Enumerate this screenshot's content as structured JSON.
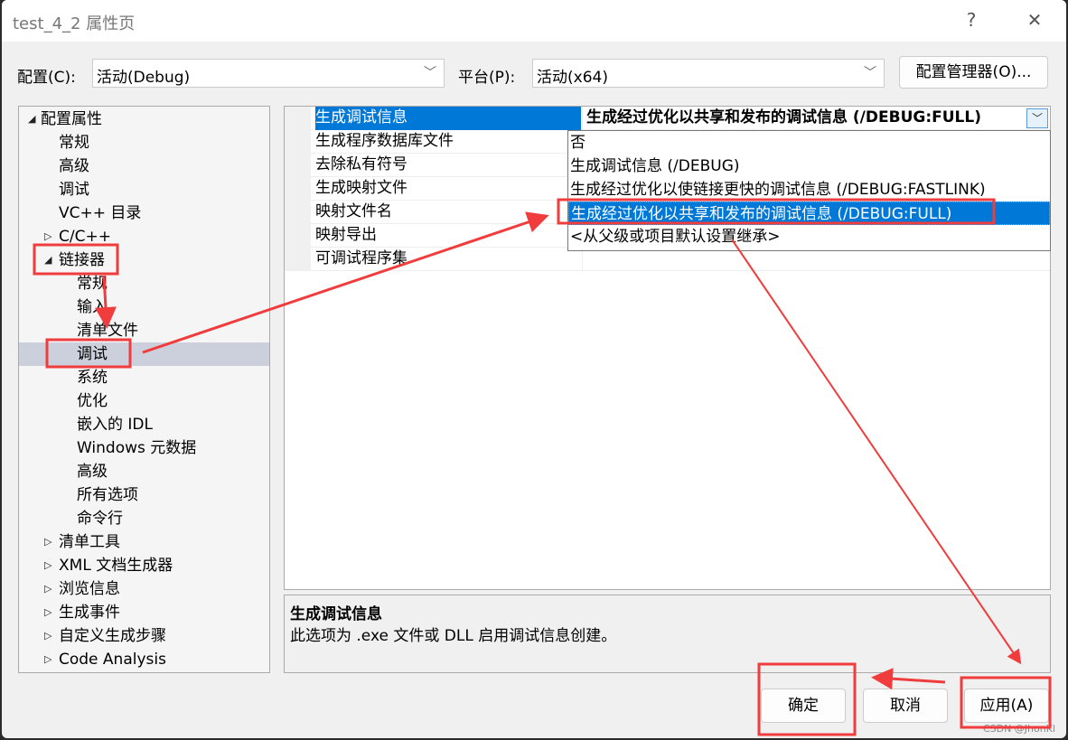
{
  "window": {
    "title": "test_4_2 属性页",
    "help": "?",
    "close": "✕"
  },
  "config": {
    "label": "配置(C):",
    "value": "活动(Debug)",
    "platform_label": "平台(P):",
    "platform_value": "活动(x64)",
    "manager_button": "配置管理器(O)..."
  },
  "tree": [
    {
      "label": "配置属性",
      "level": 0,
      "expander": "expanded"
    },
    {
      "label": "常规",
      "level": 1
    },
    {
      "label": "高级",
      "level": 1
    },
    {
      "label": "调试",
      "level": 1
    },
    {
      "label": "VC++ 目录",
      "level": 1
    },
    {
      "label": "C/C++",
      "level": 0,
      "expander": "collapsed"
    },
    {
      "label": "链接器",
      "level": 0,
      "expander": "expanded"
    },
    {
      "label": "常规",
      "level": 2
    },
    {
      "label": "输入",
      "level": 2
    },
    {
      "label": "清单文件",
      "level": 2
    },
    {
      "label": "调试",
      "level": 2,
      "selected": true
    },
    {
      "label": "系统",
      "level": 2
    },
    {
      "label": "优化",
      "level": 2
    },
    {
      "label": "嵌入的 IDL",
      "level": 2
    },
    {
      "label": "Windows 元数据",
      "level": 2
    },
    {
      "label": "高级",
      "level": 2
    },
    {
      "label": "所有选项",
      "level": 2
    },
    {
      "label": "命令行",
      "level": 2
    },
    {
      "label": "清单工具",
      "level": 0,
      "expander": "collapsed"
    },
    {
      "label": "XML 文档生成器",
      "level": 0,
      "expander": "collapsed"
    },
    {
      "label": "浏览信息",
      "level": 0,
      "expander": "collapsed"
    },
    {
      "label": "生成事件",
      "level": 0,
      "expander": "collapsed"
    },
    {
      "label": "自定义生成步骤",
      "level": 0,
      "expander": "collapsed"
    },
    {
      "label": "Code Analysis",
      "level": 0,
      "expander": "collapsed"
    }
  ],
  "grid": [
    {
      "name": "生成调试信息",
      "value": "生成经过优化以共享和发布的调试信息 (/DEBUG:FULL)",
      "selected": true
    },
    {
      "name": "生成程序数据库文件",
      "value": ""
    },
    {
      "name": "去除私有符号",
      "value": ""
    },
    {
      "name": "生成映射文件",
      "value": ""
    },
    {
      "name": "映射文件名",
      "value": ""
    },
    {
      "name": "映射导出",
      "value": ""
    },
    {
      "name": "可调试程序集",
      "value": ""
    }
  ],
  "dropdown": [
    "否",
    "生成调试信息 (/DEBUG)",
    "生成经过优化以使链接更快的调试信息 (/DEBUG:FASTLINK)",
    "生成经过优化以共享和发布的调试信息 (/DEBUG:FULL)",
    "<从父级或项目默认设置继承>"
  ],
  "dropdown_selected": 3,
  "description": {
    "title": "生成调试信息",
    "text": "此选项为 .exe 文件或 DLL 启用调试信息创建。"
  },
  "buttons": {
    "ok": "确定",
    "cancel": "取消",
    "apply": "应用(A)"
  },
  "watermark": "CSDN @JhonKl",
  "colors": {
    "selection": "#0078d7",
    "annotation": "#f03c3c",
    "tree_selection": "#ccd0dc"
  }
}
